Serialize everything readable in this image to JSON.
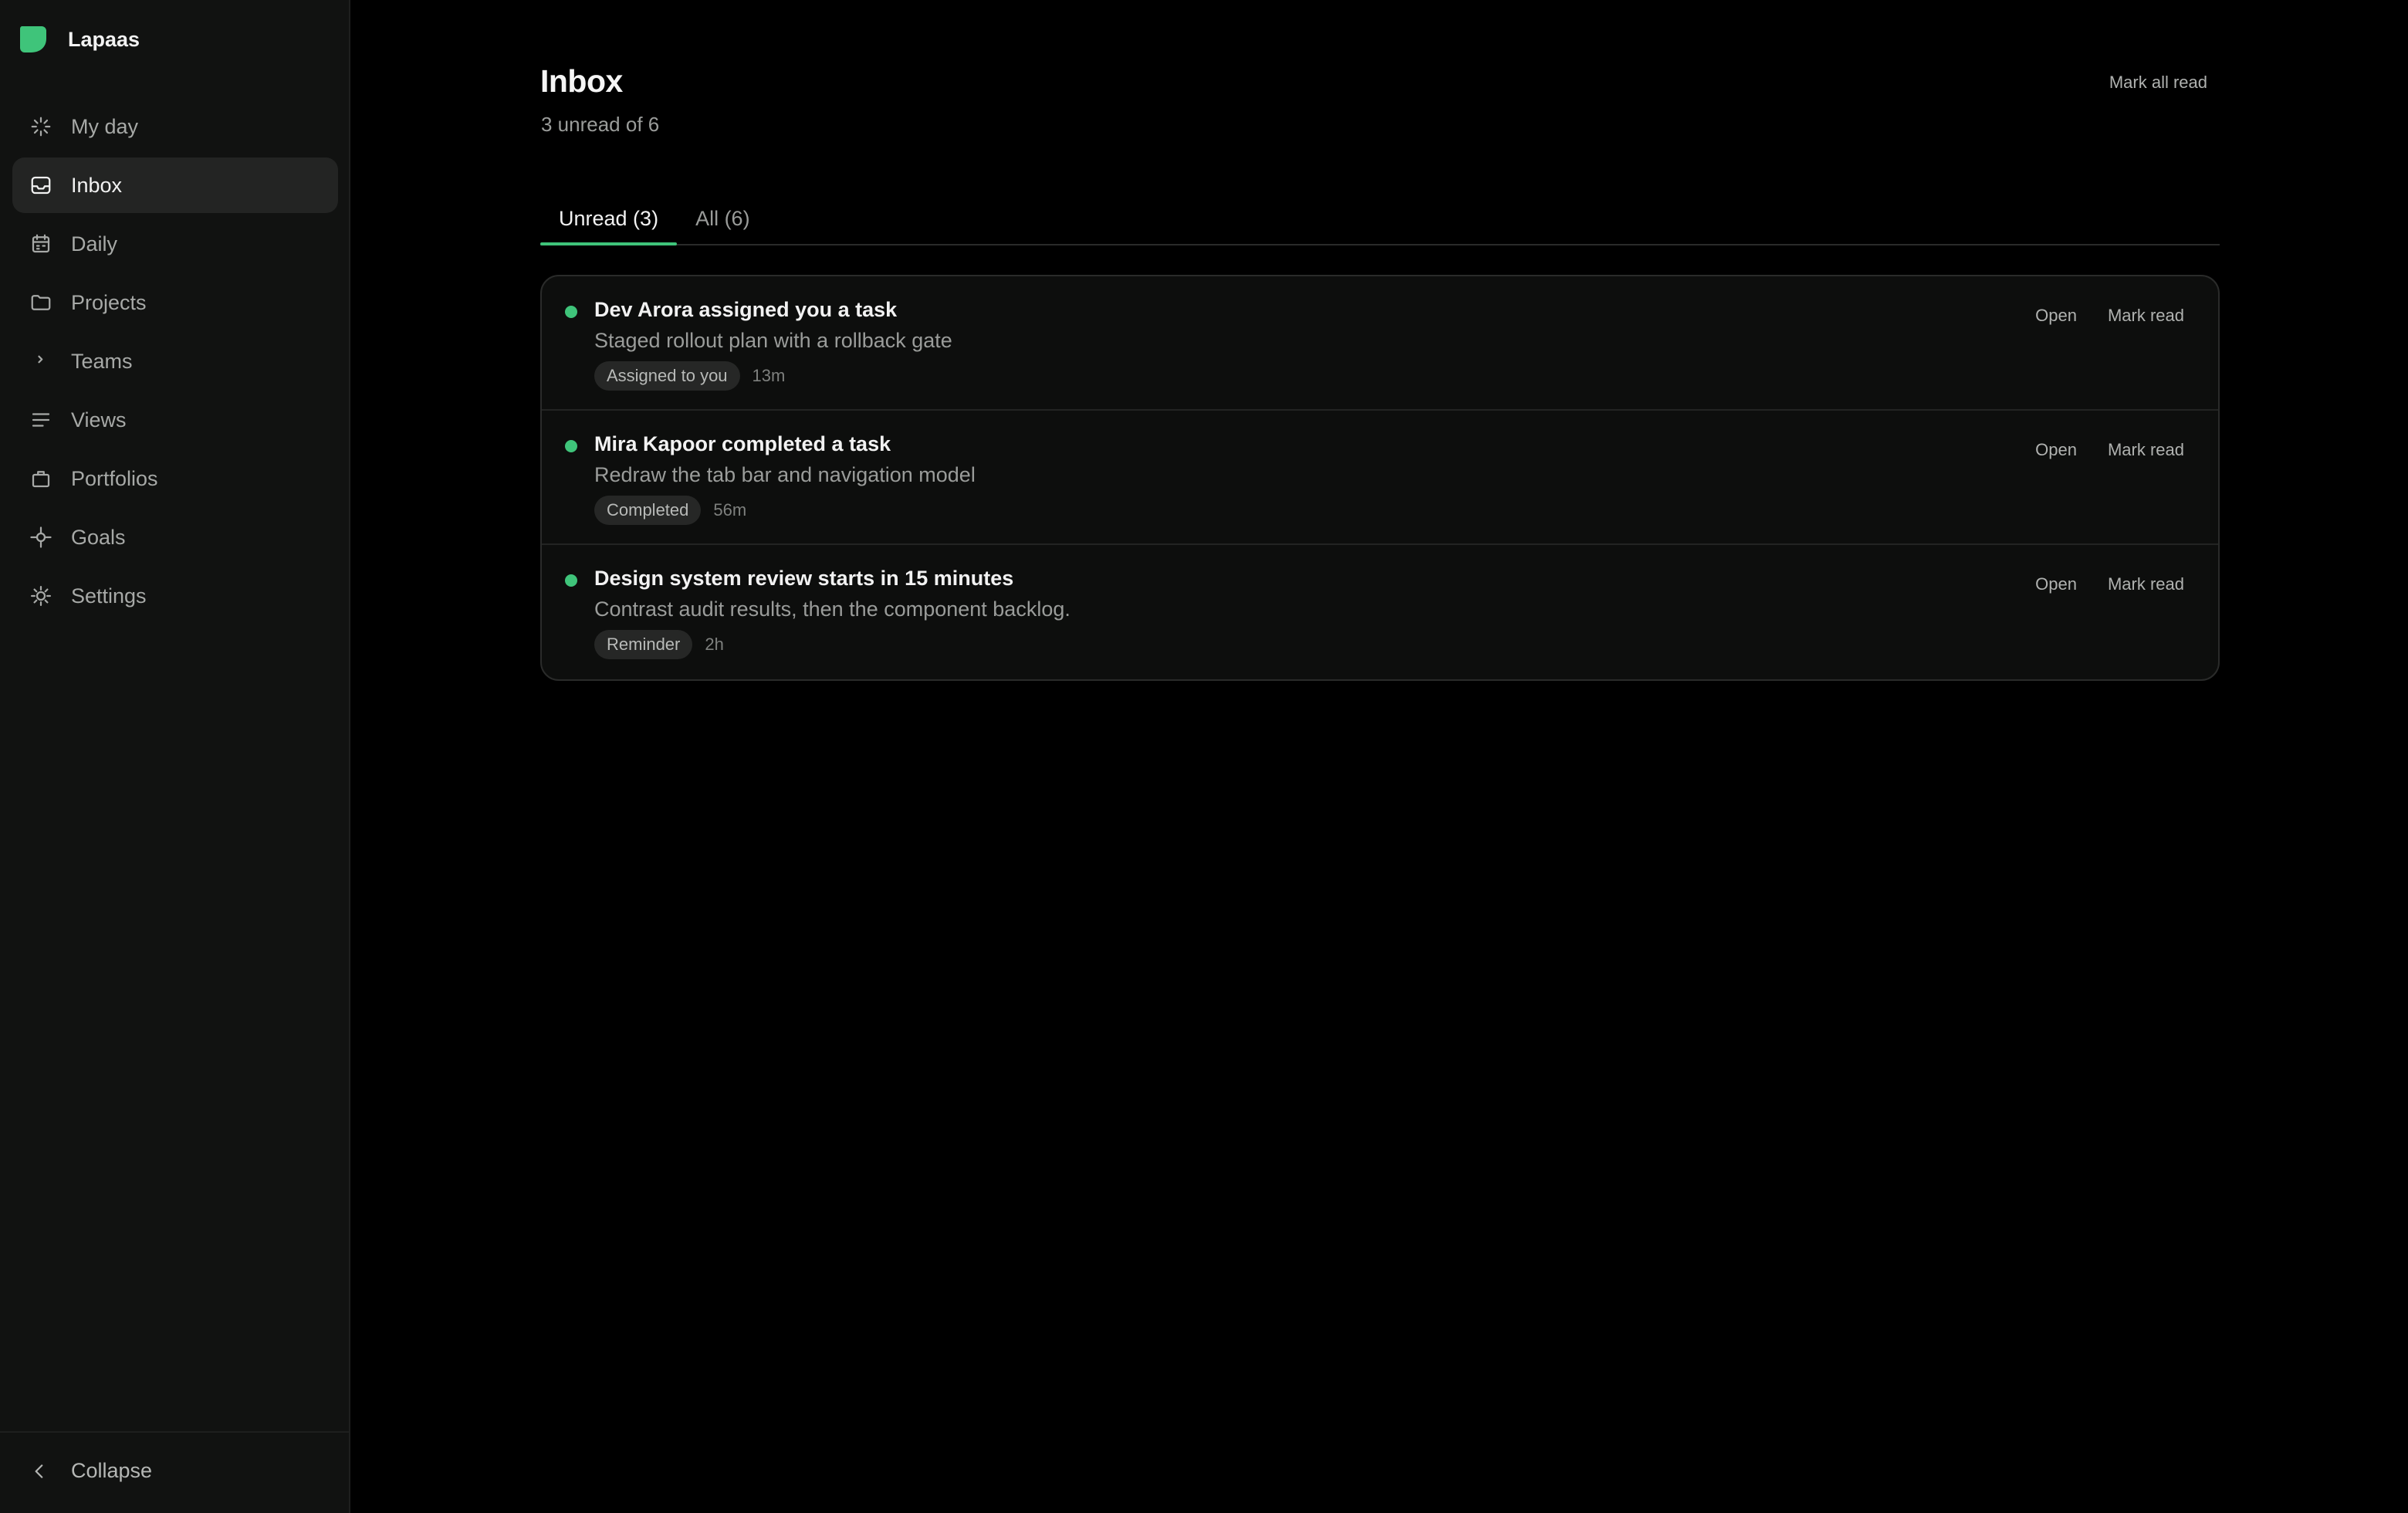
{
  "app": {
    "name": "Lapaas",
    "brand_color": "#3fc47a"
  },
  "sidebar": {
    "items": [
      {
        "label": "My day",
        "icon": "sparkle-icon",
        "active": false
      },
      {
        "label": "Inbox",
        "icon": "inbox-icon",
        "active": true
      },
      {
        "label": "Daily",
        "icon": "calendar-icon",
        "active": false
      },
      {
        "label": "Projects",
        "icon": "folder-icon",
        "active": false
      },
      {
        "label": "Teams",
        "icon": "chevron-right-icon",
        "active": false
      },
      {
        "label": "Views",
        "icon": "list-lines-icon",
        "active": false
      },
      {
        "label": "Portfolios",
        "icon": "briefcase-icon",
        "active": false
      },
      {
        "label": "Goals",
        "icon": "crosshair-icon",
        "active": false
      },
      {
        "label": "Settings",
        "icon": "gear-icon",
        "active": false
      }
    ],
    "collapse_label": "Collapse"
  },
  "header": {
    "title": "Inbox",
    "subtitle": "3 unread of 6",
    "mark_all_label": "Mark all read"
  },
  "tabs": [
    {
      "label": "Unread (3)",
      "active": true
    },
    {
      "label": "All (6)",
      "active": false
    }
  ],
  "notifications": [
    {
      "title": "Dev Arora assigned you a task",
      "description": "Staged rollout plan with a rollback gate",
      "tag": "Assigned to you",
      "time": "13m",
      "unread": true,
      "open_label": "Open",
      "mark_read_label": "Mark read"
    },
    {
      "title": "Mira Kapoor completed a task",
      "description": "Redraw the tab bar and navigation model",
      "tag": "Completed",
      "time": "56m",
      "unread": true,
      "open_label": "Open",
      "mark_read_label": "Mark read"
    },
    {
      "title": "Design system review starts in 15 minutes",
      "description": "Contrast audit results, then the component backlog.",
      "tag": "Reminder",
      "time": "2h",
      "unread": true,
      "open_label": "Open",
      "mark_read_label": "Mark read"
    }
  ]
}
